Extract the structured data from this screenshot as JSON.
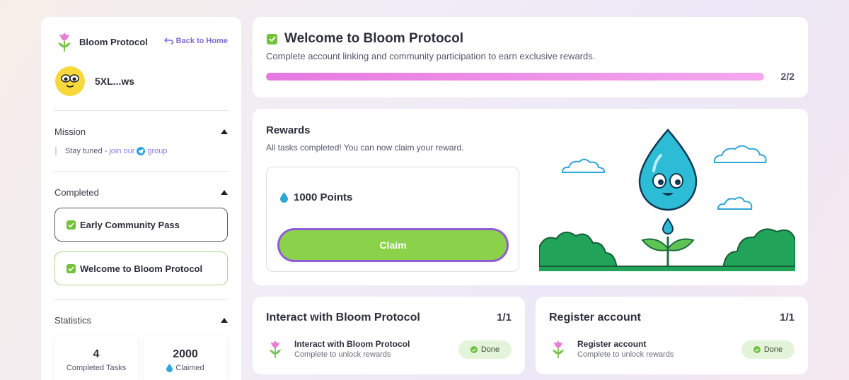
{
  "sidebar": {
    "brand": "Bloom Protocol",
    "back_label": "Back to Home",
    "username": "5XL...ws",
    "sections": {
      "mission": "Mission",
      "completed": "Completed",
      "statistics": "Statistics"
    },
    "stay_tuned": {
      "prefix": "Stay tuned -",
      "link": "join our",
      "suffix": "group"
    },
    "completed_items": [
      "Early Community Pass",
      "Welcome to Bloom Protocol"
    ],
    "stats": [
      {
        "value": "4",
        "label": "Completed Tasks"
      },
      {
        "value": "2000",
        "label": "Claimed"
      }
    ]
  },
  "welcome": {
    "title": "Welcome to Bloom Protocol",
    "subtitle": "Complete account linking and community participation to earn exclusive rewards.",
    "progress_text": "2/2",
    "progress": 1.0
  },
  "rewards": {
    "title": "Rewards",
    "subtitle": "All tasks completed! You can now claim your reward.",
    "points": "1000 Points",
    "claim_label": "Claim"
  },
  "tasks": [
    {
      "title": "Interact with Bloom Protocol",
      "count": "1/1",
      "item": "Interact with Bloom Protocol",
      "desc": "Complete to unlock rewards",
      "status": "Done"
    },
    {
      "title": "Register account",
      "count": "1/1",
      "item": "Register account",
      "desc": "Complete to unlock rewards",
      "status": "Done"
    }
  ],
  "colors": {
    "accent": "#7d6ad6",
    "claim_green": "#8cd14a",
    "progress_pink": "#e678e0",
    "done_green": "#6cc23a"
  }
}
